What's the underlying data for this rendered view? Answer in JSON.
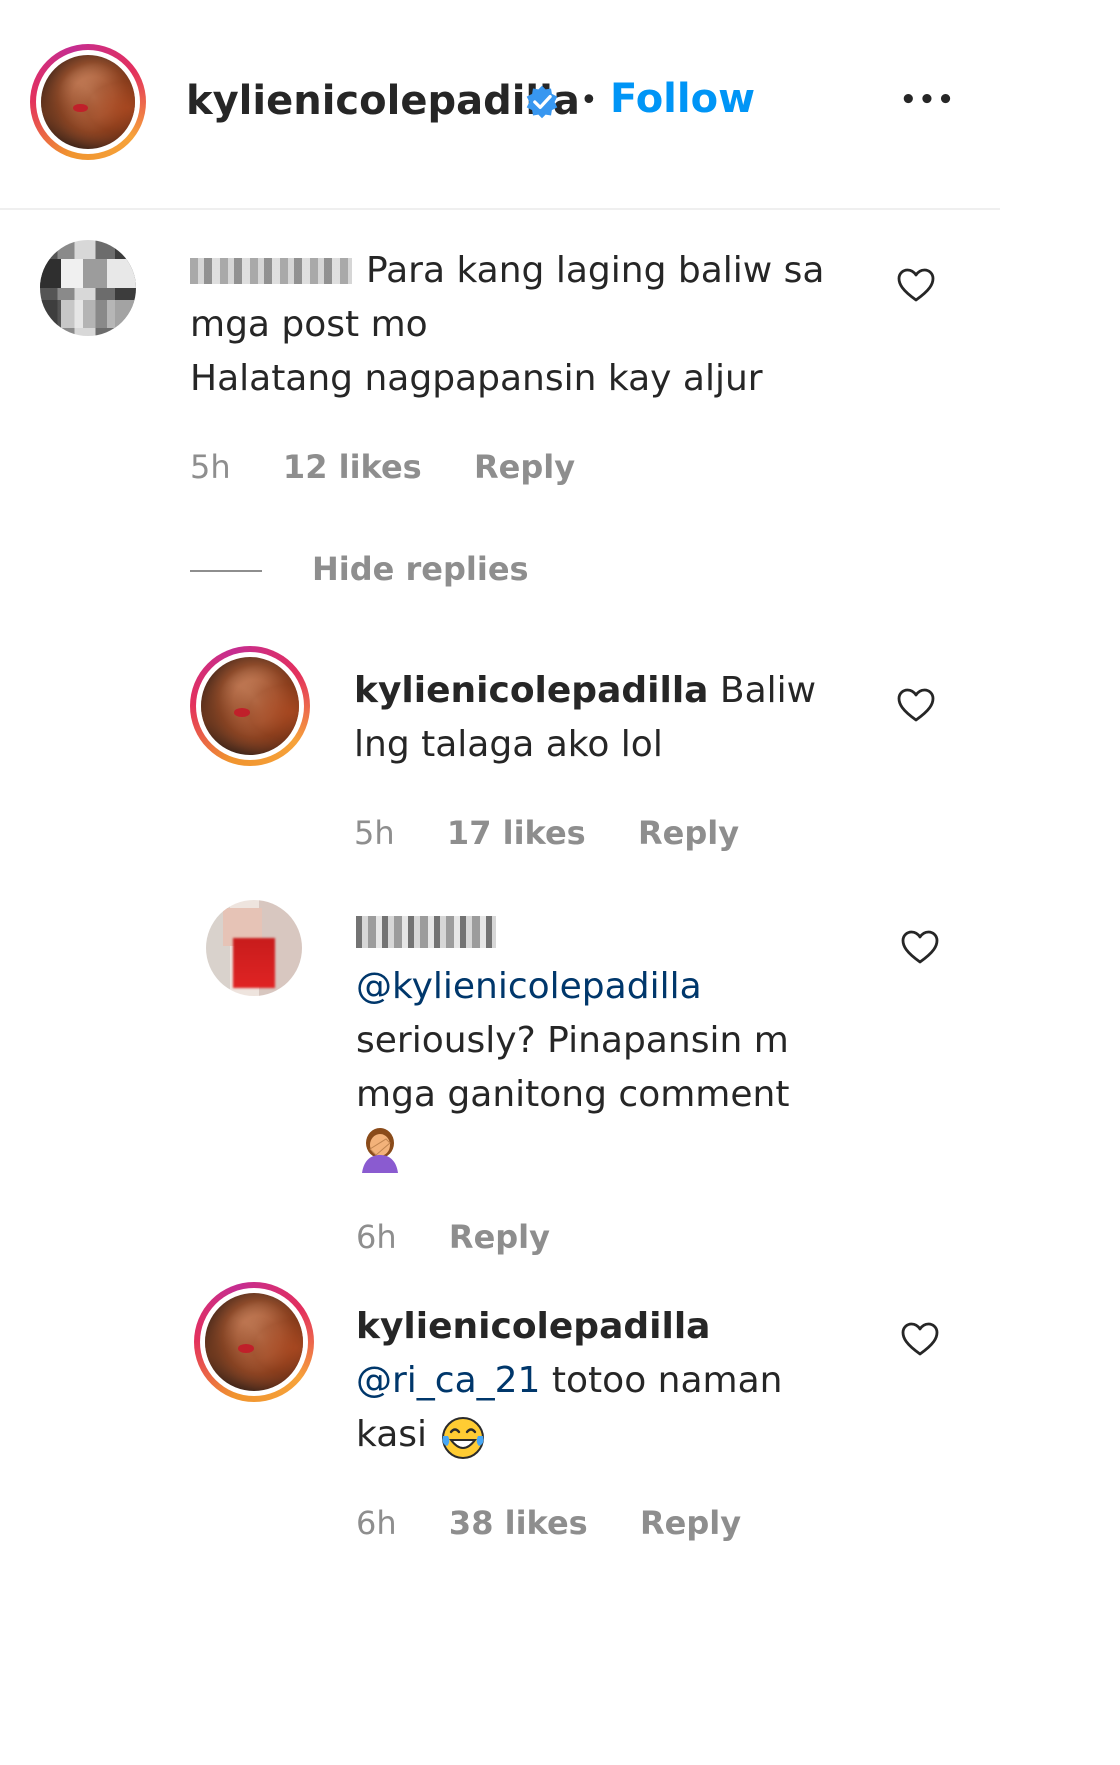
{
  "post_header": {
    "username": "kylienicolepadilla",
    "verified": true,
    "separator": "•",
    "follow_label": "Follow",
    "more_label": "•••"
  },
  "comment": {
    "username_blurred": true,
    "text_line1": "Para kang laging baliw sa",
    "text_line2": "mga post mo",
    "text_line3": "Halatang nagpapansin kay aljur",
    "time": "5h",
    "likes": "12 likes",
    "reply_label": "Reply",
    "hide_replies_label": "Hide replies"
  },
  "replies": [
    {
      "username": "kylienicolepadilla",
      "text_line1": "Baliw",
      "text_line2": "lng talaga ako lol",
      "time": "5h",
      "likes": "17 likes",
      "reply_label": "Reply"
    },
    {
      "username_blurred_hint": "ri_ca_21",
      "mention": "@kylienicolepadilla",
      "text_line1": "seriously? Pinapansin m",
      "text_line2": "mga ganitong comment",
      "emoji": "woman-facepalming",
      "time": "6h",
      "reply_label": "Reply"
    },
    {
      "username": "kylienicolepadilla",
      "mention": "@ri_ca_21",
      "text_line1": " totoo naman",
      "text_line2": "kasi",
      "emoji": "face-with-tears-of-joy",
      "time": "6h",
      "likes": "38 likes",
      "reply_label": "Reply"
    }
  ],
  "colors": {
    "follow_blue": "#0095f6",
    "verified_blue": "#3897f0",
    "mention_blue": "#00376b",
    "meta_gray": "#8e8e8e",
    "divider": "#efefef"
  }
}
